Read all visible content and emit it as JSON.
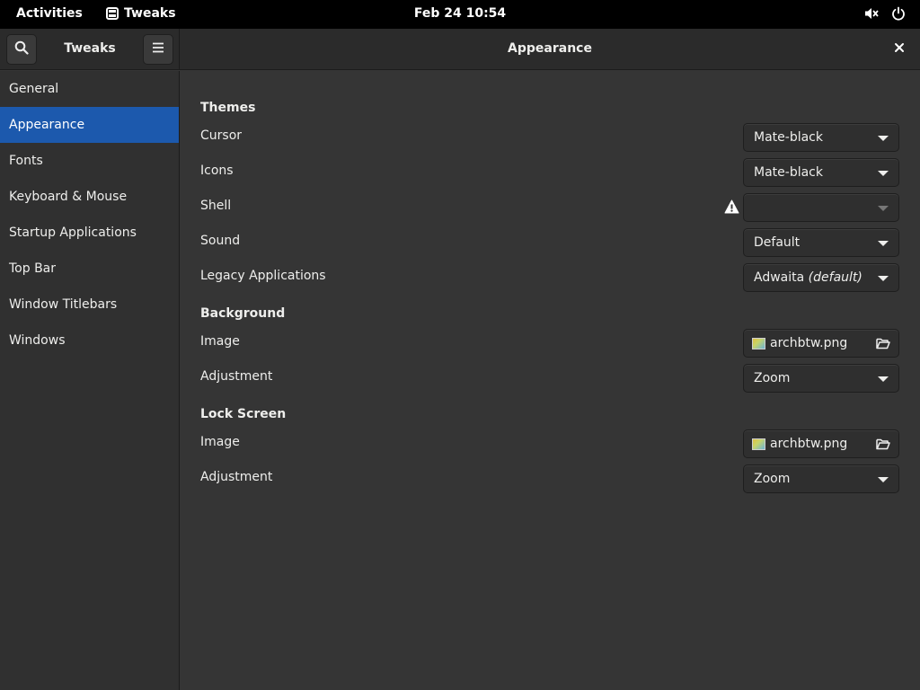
{
  "topbar": {
    "activities": "Activities",
    "app_name": "Tweaks",
    "clock": "Feb 24  10:54",
    "icons": [
      "grid-icon",
      "speaker-muted-icon",
      "power-icon"
    ]
  },
  "header": {
    "left_title": "Tweaks",
    "title": "Appearance",
    "icons": [
      "search-icon",
      "hamburger-menu-icon",
      "close-icon"
    ]
  },
  "sidebar": {
    "items": [
      {
        "label": "General"
      },
      {
        "label": "Appearance",
        "active": true
      },
      {
        "label": "Fonts"
      },
      {
        "label": "Keyboard & Mouse"
      },
      {
        "label": "Startup Applications"
      },
      {
        "label": "Top Bar"
      },
      {
        "label": "Window Titlebars"
      },
      {
        "label": "Windows"
      }
    ]
  },
  "themes": {
    "heading": "Themes",
    "cursor": {
      "label": "Cursor",
      "value": "Mate-black"
    },
    "icons": {
      "label": "Icons",
      "value": "Mate-black"
    },
    "shell": {
      "label": "Shell",
      "value": "",
      "warning": true
    },
    "sound": {
      "label": "Sound",
      "value": "Default"
    },
    "legacy": {
      "label": "Legacy Applications",
      "value": "Adwaita",
      "suffix": "(default)"
    }
  },
  "background": {
    "heading": "Background",
    "image": {
      "label": "Image",
      "value": "archbtw.png"
    },
    "adjustment": {
      "label": "Adjustment",
      "value": "Zoom"
    }
  },
  "lockscreen": {
    "heading": "Lock Screen",
    "image": {
      "label": "Image",
      "value": "archbtw.png"
    },
    "adjustment": {
      "label": "Adjustment",
      "value": "Zoom"
    }
  },
  "colors": {
    "accent": "#1c59ad",
    "window_bg": "#353535",
    "sidebar_bg": "#303030",
    "header_bg": "#2b2b2b"
  }
}
